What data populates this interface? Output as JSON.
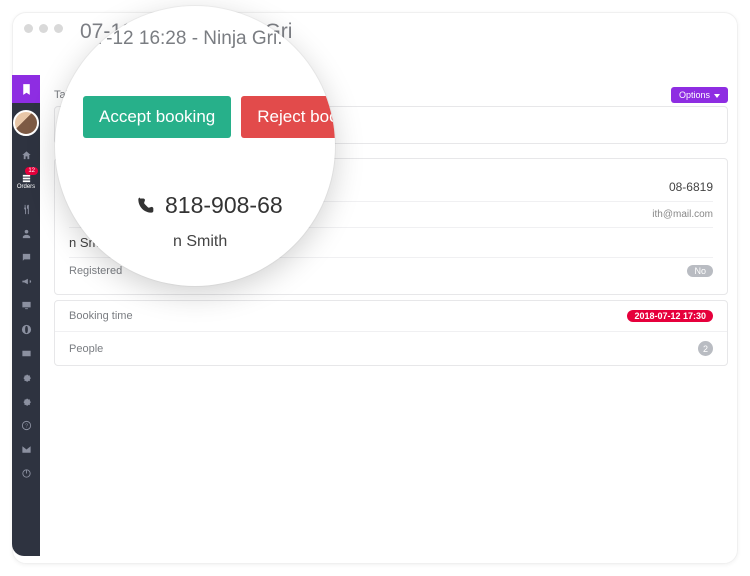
{
  "header": {
    "title": "07-12 16:28 - Ninja Gri"
  },
  "toprow": {
    "table_label": "Table",
    "options_label": "Options"
  },
  "sidebar": {
    "orders_label": "Orders",
    "orders_badge": "12"
  },
  "details": {
    "phone_partial": "08-6819",
    "email": "ith@mail.com",
    "name_partial": "n Smith",
    "registered_label": "Registered",
    "registered_value": "No"
  },
  "booking": {
    "time_label": "Booking time",
    "time_value": "2018-07-12 17:30",
    "people_label": "People",
    "people_value": "2"
  },
  "lens": {
    "title": "07-12 16:28 - Ninja Gri.",
    "accept_label": "Accept booking",
    "reject_label": "Reject booking",
    "phone": "818-908-68",
    "name": "n Smith"
  }
}
